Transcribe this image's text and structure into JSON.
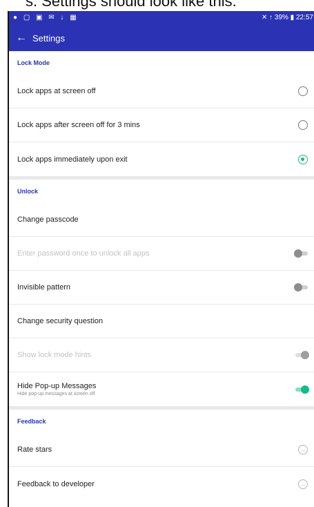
{
  "caption": "s. Settings should look like this.",
  "statusbar": {
    "left_icons": "● ▢ ▣ ✉ ↓ ▦",
    "right": "✕ ↑ 39% ▮ 22:57"
  },
  "appbar": {
    "back_icon": "←",
    "title": "Settings"
  },
  "sections": {
    "lock_mode": {
      "header": "Lock Mode",
      "items": [
        {
          "label": "Lock apps at screen off",
          "selected": false
        },
        {
          "label": "Lock apps after screen off for 3 mins",
          "selected": false
        },
        {
          "label": "Lock apps immediately upon exit",
          "selected": true
        }
      ]
    },
    "unlock": {
      "header": "Unlock",
      "change_passcode": "Change passcode",
      "enter_password_once": "Enter password once to unlock all apps",
      "invisible_pattern": "Invisible pattern",
      "change_security_question": "Change security question",
      "show_lock_mode_hints": "Show lock mode hints",
      "hide_popup_messages": "Hide Pop-up Messages",
      "hide_popup_messages_sub": "Hide pop-up messages at screen off"
    },
    "feedback": {
      "header": "Feedback",
      "rate_stars": "Rate stars",
      "feedback_to_developer": "Feedback to developer",
      "nav_icon": "→"
    }
  },
  "toggles": {
    "enter_password_once": false,
    "invisible_pattern": false,
    "show_lock_mode_hints": true,
    "hide_popup_messages": true
  },
  "colors": {
    "primary": "#2b33b4",
    "accent": "#19b98c"
  }
}
